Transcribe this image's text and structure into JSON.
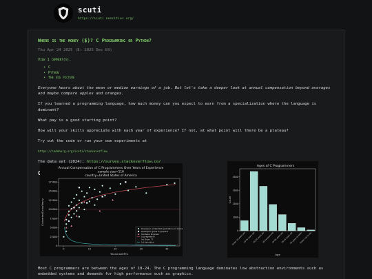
{
  "site": {
    "title": "scuti",
    "url": "https://scuti.neocities.org/"
  },
  "post": {
    "title": "Where is the money ($)? C Programming or Python?",
    "dates": "Thu Apr 24 2025 (E: 2025 Dec 03)",
    "comments": "View 1 comment(s).",
    "tags": [
      "C",
      "Python",
      "The big picture"
    ],
    "intro": "Everyone hears about the mean or median earnings of a job. But let's take a deeper look at annual compensation beyond averages and maybe compare apples and oranges.",
    "q1": "If you learned a programming language, how much money can you expect to earn from a specialization where the language is dominant?",
    "q2": "What pay is a good starting point?",
    "q3": "How will your skills appreciate with each year of experience? If not, at what point will there be a plateau?",
    "try_text": "Try out the code or run your own experiments at",
    "code_link": "https://codeberg.org/scuti/stackoverflow",
    "dataset_label": "The data set (2024):",
    "dataset_link": "https://survey.stackoverflow.co/",
    "section_c": "C",
    "bottom": "Most C programmers are between the ages of 18-24. The C programming language dominates low abstraction environments such as embedded systems and demands for high performance such as graphics."
  },
  "chart_data": [
    {
      "type": "scatter",
      "title": "Annual Compensation of C Programmers Over Years of Experience",
      "subtitle1": "sample size=116",
      "subtitle2": "country=United States of America",
      "xlabel": "YearsCodePro",
      "ylabel": "ConvertedCompYearly",
      "xticks": [
        "0",
        "10",
        "20",
        "30",
        "40"
      ],
      "yticks": [
        "0",
        "25000",
        "50000",
        "75000",
        "100000",
        "125000",
        "150000",
        "175000"
      ],
      "xlim": [
        -2,
        45
      ],
      "ylim": [
        0,
        185000
      ],
      "legend_position": "lower-right",
      "legend": [
        "Developer, embedded applications or devices",
        "Developer, game or graphics",
        "Hardware Engineer",
        "Log regression",
        "Inv.Slope: 77",
        "1st derivative"
      ],
      "colors": {
        "embedded": "#c8f0e3",
        "game": "#e6f5ff",
        "hardware": "#f08fa6",
        "logreg": "#b5454e",
        "derivative": "#3fb8bd"
      },
      "points": [
        {
          "x": 1,
          "y": 60000,
          "g": "embedded"
        },
        {
          "x": 1,
          "y": 72000,
          "g": "embedded"
        },
        {
          "x": 2,
          "y": 85000,
          "g": "embedded"
        },
        {
          "x": 2,
          "y": 95000,
          "g": "embedded"
        },
        {
          "x": 2,
          "y": 110000,
          "g": "embedded"
        },
        {
          "x": 3,
          "y": 78000,
          "g": "embedded"
        },
        {
          "x": 3,
          "y": 102000,
          "g": "embedded"
        },
        {
          "x": 3,
          "y": 120000,
          "g": "embedded"
        },
        {
          "x": 4,
          "y": 88000,
          "g": "embedded"
        },
        {
          "x": 4,
          "y": 130000,
          "g": "embedded"
        },
        {
          "x": 5,
          "y": 96000,
          "g": "embedded"
        },
        {
          "x": 5,
          "y": 112000,
          "g": "embedded"
        },
        {
          "x": 5,
          "y": 140000,
          "g": "embedded"
        },
        {
          "x": 6,
          "y": 105000,
          "g": "embedded"
        },
        {
          "x": 6,
          "y": 125000,
          "g": "embedded"
        },
        {
          "x": 7,
          "y": 118000,
          "g": "embedded"
        },
        {
          "x": 7,
          "y": 150000,
          "g": "embedded"
        },
        {
          "x": 8,
          "y": 100000,
          "g": "embedded"
        },
        {
          "x": 8,
          "y": 135000,
          "g": "embedded"
        },
        {
          "x": 9,
          "y": 145000,
          "g": "embedded"
        },
        {
          "x": 10,
          "y": 122000,
          "g": "embedded"
        },
        {
          "x": 10,
          "y": 160000,
          "g": "embedded"
        },
        {
          "x": 11,
          "y": 132000,
          "g": "embedded"
        },
        {
          "x": 12,
          "y": 155000,
          "g": "embedded"
        },
        {
          "x": 13,
          "y": 128000,
          "g": "embedded"
        },
        {
          "x": 14,
          "y": 148000,
          "g": "embedded"
        },
        {
          "x": 15,
          "y": 165000,
          "g": "embedded"
        },
        {
          "x": 16,
          "y": 138000,
          "g": "embedded"
        },
        {
          "x": 18,
          "y": 158000,
          "g": "embedded"
        },
        {
          "x": 20,
          "y": 142000,
          "g": "embedded"
        },
        {
          "x": 22,
          "y": 170000,
          "g": "embedded"
        },
        {
          "x": 25,
          "y": 152000,
          "g": "embedded"
        },
        {
          "x": 28,
          "y": 162000,
          "g": "embedded"
        },
        {
          "x": 32,
          "y": 145000,
          "g": "embedded"
        },
        {
          "x": 40,
          "y": 168000,
          "g": "embedded"
        },
        {
          "x": 43,
          "y": 172000,
          "g": "embedded"
        },
        {
          "x": 1,
          "y": 40000,
          "g": "embedded"
        },
        {
          "x": 0,
          "y": 25000,
          "g": "embedded"
        },
        {
          "x": 6,
          "y": 80000,
          "g": "embedded"
        },
        {
          "x": 12,
          "y": 112000,
          "g": "embedded"
        },
        {
          "x": 2,
          "y": 68000,
          "g": "game"
        },
        {
          "x": 4,
          "y": 105000,
          "g": "game"
        },
        {
          "x": 6,
          "y": 160000,
          "g": "game"
        },
        {
          "x": 9,
          "y": 118000,
          "g": "game"
        },
        {
          "x": 15,
          "y": 135000,
          "g": "game"
        },
        {
          "x": 24,
          "y": 175000,
          "g": "game"
        },
        {
          "x": 3,
          "y": 55000,
          "g": "hardware"
        },
        {
          "x": 5,
          "y": 82000,
          "g": "hardware"
        },
        {
          "x": 8,
          "y": 120000,
          "g": "hardware"
        },
        {
          "x": 14,
          "y": 96000,
          "g": "hardware"
        },
        {
          "x": 19,
          "y": 126000,
          "g": "hardware"
        },
        {
          "x": 1,
          "y": 50000,
          "g": "hardware"
        }
      ],
      "reference_line_y": 100000
    },
    {
      "type": "bar",
      "title": "Ages of C Programmers",
      "xlabel": "Age",
      "ylabel": "Count",
      "categories": [
        "Under 18 years old",
        "18-24 years old",
        "25-34 years old",
        "35-44 years old",
        "45-54 years old",
        "55-64 years old",
        "65 years or older",
        "Prefer not to say"
      ],
      "values": [
        750,
        4400,
        3300,
        1950,
        1200,
        550,
        230,
        60
      ],
      "yticks": [
        "0",
        "1000",
        "2000",
        "3000",
        "4000"
      ],
      "ylim": [
        0,
        4600
      ],
      "bar_color": "#a3dbd2",
      "bar_edge": "#d9f2ec"
    }
  ]
}
